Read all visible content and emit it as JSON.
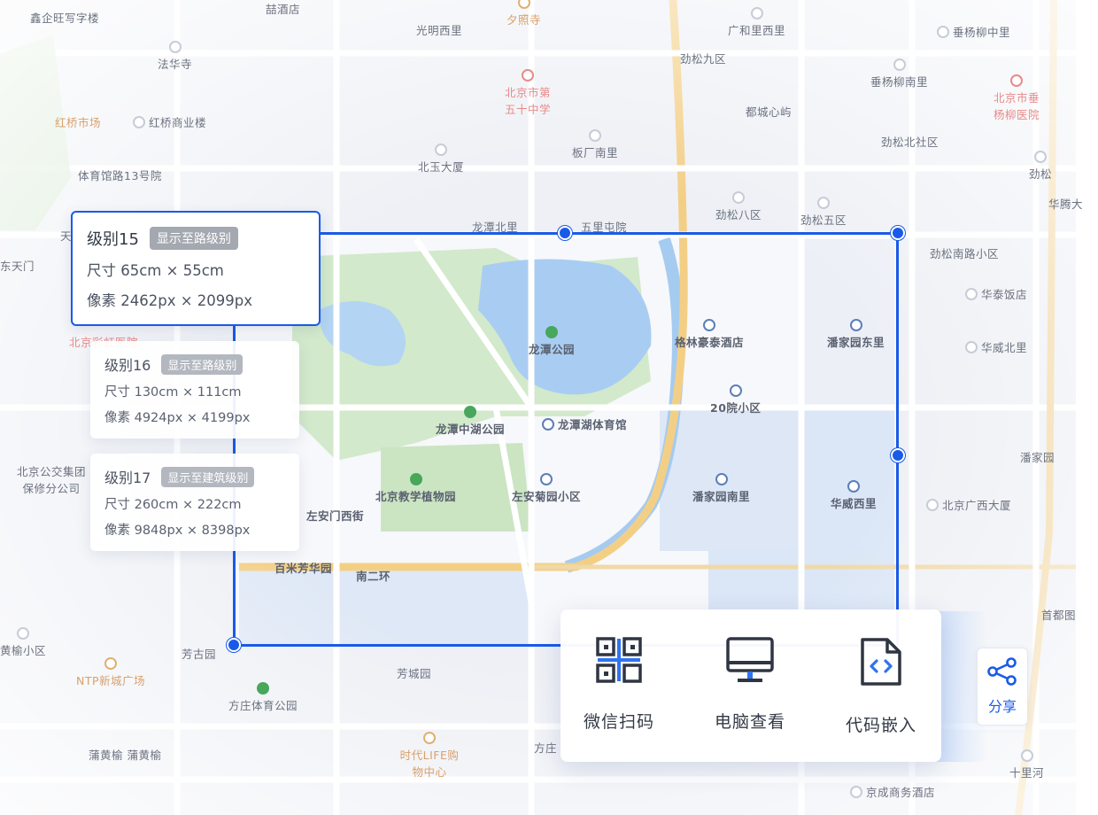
{
  "map": {
    "places": [
      {
        "text": "鑫企旺写字楼",
        "style": "dim"
      },
      {
        "text": "喆酒店",
        "style": "dim"
      },
      {
        "text": "夕照寺",
        "style": "orange"
      },
      {
        "text": "光明西里",
        "style": "dim"
      },
      {
        "text": "广和里西里",
        "style": "dim"
      },
      {
        "text": "垂杨柳中里",
        "style": "dim"
      },
      {
        "text": "法华寺",
        "style": "dim"
      },
      {
        "text": "北京市第五十中学",
        "style": "pink"
      },
      {
        "text": "劲松九区",
        "style": "dim"
      },
      {
        "text": "垂杨柳南里",
        "style": "dim"
      },
      {
        "text": "北京市垂杨柳医院",
        "style": "pink"
      },
      {
        "text": "红桥市场",
        "style": "orange"
      },
      {
        "text": "红桥商业楼",
        "style": "dim"
      },
      {
        "text": "都城心屿",
        "style": "dim"
      },
      {
        "text": "劲松北社区",
        "style": "dim"
      },
      {
        "text": "板厂南里",
        "style": "dim"
      },
      {
        "text": "体育馆路13号院",
        "style": "dim"
      },
      {
        "text": "北玉大厦",
        "style": "dim"
      },
      {
        "text": "劲松",
        "style": "dim"
      },
      {
        "text": "龙潭北里",
        "style": "dim"
      },
      {
        "text": "五里屯院",
        "style": "dim"
      },
      {
        "text": "劲松八区",
        "style": "dim"
      },
      {
        "text": "劲松五区",
        "style": "dim"
      },
      {
        "text": "华腾大",
        "style": "dim"
      },
      {
        "text": "劲松南路小区",
        "style": "dim"
      },
      {
        "text": "龙潭公园",
        "style": "inner"
      },
      {
        "text": "格林豪泰酒店",
        "style": "inner"
      },
      {
        "text": "潘家园东里",
        "style": "inner"
      },
      {
        "text": "华泰饭店",
        "style": "dim"
      },
      {
        "text": "华威北里",
        "style": "dim"
      },
      {
        "text": "20院小区",
        "style": "inner"
      },
      {
        "text": "龙潭中湖公园",
        "style": "inner"
      },
      {
        "text": "龙潭湖体育馆",
        "style": "inner"
      },
      {
        "text": "北京公交集团保修分公司",
        "style": "dim"
      },
      {
        "text": "潘家园",
        "style": "dim"
      },
      {
        "text": "北京教学植物园",
        "style": "inner"
      },
      {
        "text": "左安菊园小区",
        "style": "inner"
      },
      {
        "text": "潘家园南里",
        "style": "inner"
      },
      {
        "text": "华威西里",
        "style": "inner"
      },
      {
        "text": "北京广西大厦",
        "style": "dim"
      },
      {
        "text": "左安门西街",
        "style": "inner"
      },
      {
        "text": "百米芳华园",
        "style": "inner"
      },
      {
        "text": "南二环",
        "style": "inner"
      },
      {
        "text": "首都图",
        "style": "dim"
      },
      {
        "text": "黄榆小区",
        "style": "dim"
      },
      {
        "text": "芳古园",
        "style": "dim"
      },
      {
        "text": "NTP新城广场",
        "style": "orange"
      },
      {
        "text": "芳城园",
        "style": "dim"
      },
      {
        "text": "方庄体育公园",
        "style": "dim"
      },
      {
        "text": "蒲黄榆 蒲黄榆",
        "style": "dim"
      },
      {
        "text": "时代LIFE购物中心",
        "style": "orange"
      },
      {
        "text": "方庄",
        "style": "dim"
      },
      {
        "text": "京成商务酒店",
        "style": "dim"
      },
      {
        "text": "十里河",
        "style": "dim"
      },
      {
        "text": "北京彩虹医院",
        "style": "pink"
      },
      {
        "text": "天",
        "style": "dim"
      },
      {
        "text": "东天门",
        "style": "dim"
      }
    ]
  },
  "levels": [
    {
      "title": "级别15",
      "tag": "显示至路级别",
      "size": "尺寸 65cm × 55cm",
      "pixels": "像素 2462px × 2099px"
    },
    {
      "title": "级别16",
      "tag": "显示至路级别",
      "size": "尺寸 130cm × 111cm",
      "pixels": "像素 4924px × 4199px"
    },
    {
      "title": "级别17",
      "tag": "显示至建筑级别",
      "size": "尺寸 260cm × 222cm",
      "pixels": "像素 9848px × 8398px"
    }
  ],
  "share": {
    "items": [
      {
        "label": "微信扫码",
        "icon": "qr-code-icon"
      },
      {
        "label": "电脑查看",
        "icon": "monitor-icon"
      },
      {
        "label": "代码嵌入",
        "icon": "code-file-icon"
      }
    ],
    "button_label": "分享",
    "button_icon": "share-icon"
  },
  "colors": {
    "accent": "#1a5ae8",
    "park": "#cfe8c5",
    "water": "#a9cdf2",
    "ring_road": "#f3cf86"
  }
}
